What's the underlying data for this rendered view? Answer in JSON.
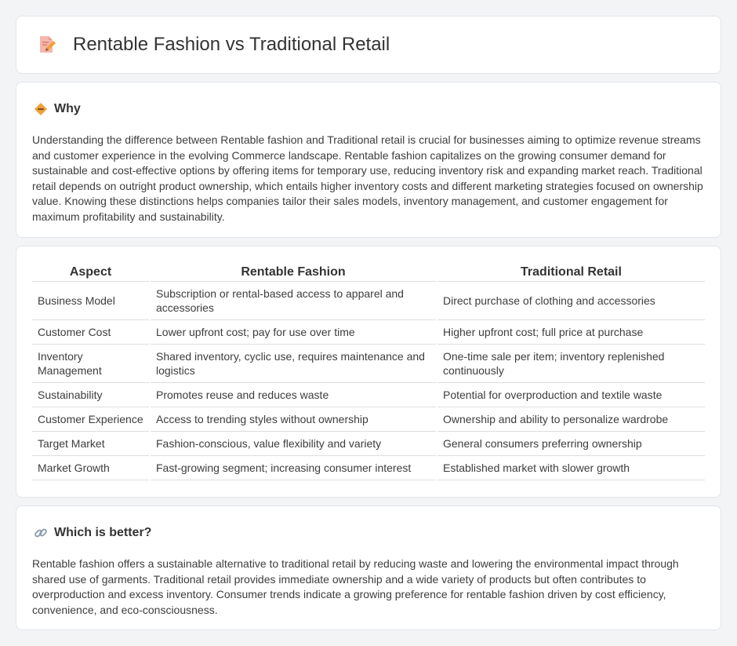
{
  "page": {
    "title": "Rentable Fashion vs Traditional Retail",
    "title_icon": "document-pencil-icon"
  },
  "why": {
    "heading": "Why",
    "icon": "diamond-sparkle-icon",
    "body": "Understanding the difference between Rentable fashion and Traditional retail is crucial for businesses aiming to optimize revenue streams and customer experience in the evolving Commerce landscape. Rentable fashion capitalizes on the growing consumer demand for sustainable and cost-effective options by offering items for temporary use, reducing inventory risk and expanding market reach. Traditional retail depends on outright product ownership, which entails higher inventory costs and different marketing strategies focused on ownership value. Knowing these distinctions helps companies tailor their sales models, inventory management, and customer engagement for maximum profitability and sustainability."
  },
  "table": {
    "headers": [
      "Aspect",
      "Rentable Fashion",
      "Traditional Retail"
    ],
    "rows": [
      [
        "Business Model",
        "Subscription or rental-based access to apparel and accessories",
        "Direct purchase of clothing and accessories"
      ],
      [
        "Customer Cost",
        "Lower upfront cost; pay for use over time",
        "Higher upfront cost; full price at purchase"
      ],
      [
        "Inventory Management",
        "Shared inventory, cyclic use, requires maintenance and logistics",
        "One-time sale per item; inventory replenished continuously"
      ],
      [
        "Sustainability",
        "Promotes reuse and reduces waste",
        "Potential for overproduction and textile waste"
      ],
      [
        "Customer Experience",
        "Access to trending styles without ownership",
        "Ownership and ability to personalize wardrobe"
      ],
      [
        "Target Market",
        "Fashion-conscious, value flexibility and variety",
        "General consumers preferring ownership"
      ],
      [
        "Market Growth",
        "Fast-growing segment; increasing consumer interest",
        "Established market with slower growth"
      ]
    ]
  },
  "better": {
    "heading": "Which is better?",
    "icon": "link-icon",
    "body": "Rentable fashion offers a sustainable alternative to traditional retail by reducing waste and lowering the environmental impact through shared use of garments. Traditional retail provides immediate ownership and a wide variety of products but often contributes to overproduction and excess inventory. Consumer trends indicate a growing preference for rentable fashion driven by cost efficiency, convenience, and eco-consciousness."
  },
  "colors": {
    "background": "#f3f4f6",
    "card": "#ffffff",
    "accent_orange": "#f0a23b",
    "icon_pink": "#e8837a"
  }
}
